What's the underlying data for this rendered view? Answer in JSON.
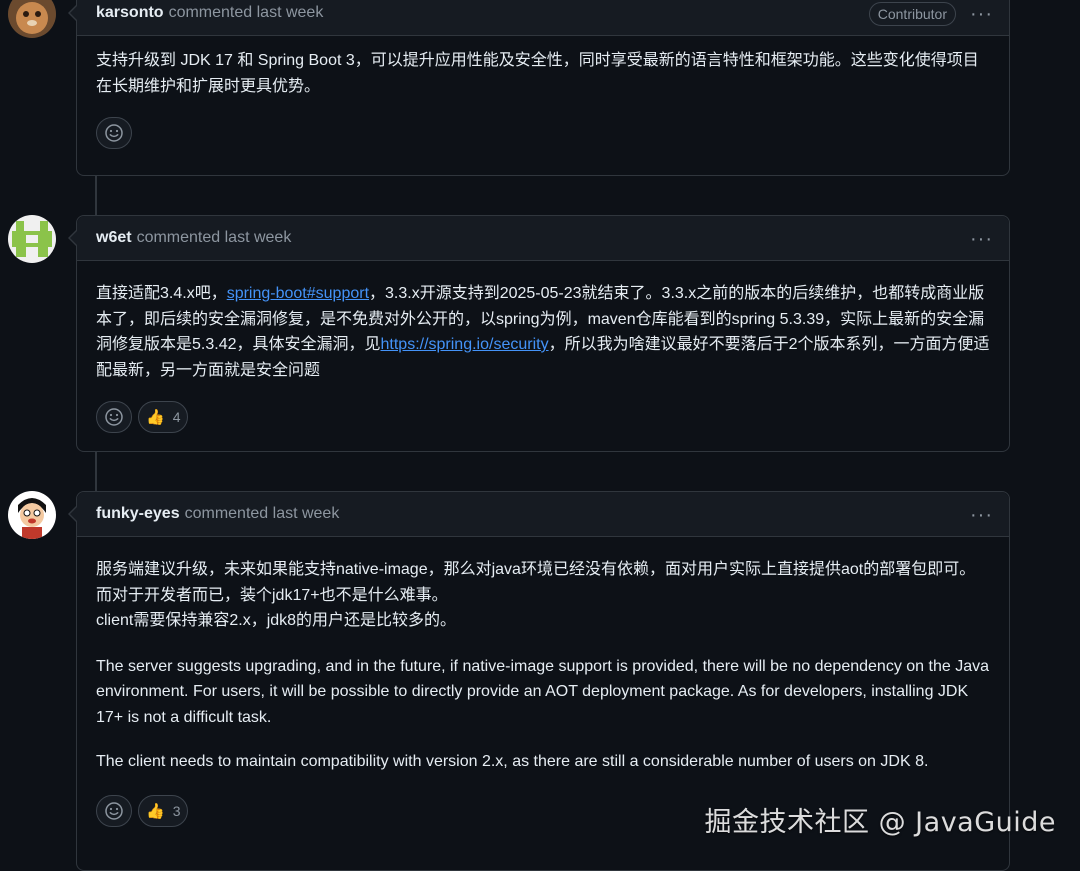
{
  "comments": [
    {
      "author": "karsonto",
      "meta": "commented last week",
      "badge": "Contributor",
      "kebab": "···",
      "body_p1": "支持升级到 JDK 17 和 Spring Boot 3，可以提升应用性能及安全性，同时享受最新的语言特性和框架功能。这些变化使得项目在长期维护和扩展时更具优势。"
    },
    {
      "author": "w6et",
      "meta": "commented last week",
      "kebab": "···",
      "body_a": "直接适配3.4.x吧，",
      "link1": "spring-boot#support",
      "body_b": "，3.3.x开源支持到2025-05-23就结束了。3.3.x之前的版本的后续维护，也都转成商业版本了，即后续的安全漏洞修复，是不免费对外公开的，以spring为例，maven仓库能看到的spring 5.3.39，实际上最新的安全漏洞修复版本是5.3.42，具体安全漏洞，见",
      "link2": "https://spring.io/security",
      "body_c": "，所以我为啥建议最好不要落后于2个版本系列，一方面方便适配最新，另一方面就是安全问题",
      "thumbs_count": "4"
    },
    {
      "author": "funky-eyes",
      "meta": "commented last week",
      "kebab": "···",
      "body_p1_line1": "服务端建议升级，未来如果能支持native-image，那么对java环境已经没有依赖，面对用户实际上直接提供aot的部署包即可。而对于开发者而已，装个jdk17+也不是什么难事。",
      "body_p1_line2": "client需要保持兼容2.x，jdk8的用户还是比较多的。",
      "body_p2": "The server suggests upgrading, and in the future, if native-image support is provided, there will be no dependency on the Java environment. For users, it will be possible to directly provide an AOT deployment package. As for developers, installing JDK 17+ is not a difficult task.",
      "body_p3": "The client needs to maintain compatibility with version 2.x, as there are still a considerable number of users on JDK 8.",
      "thumbs_count": "3"
    }
  ],
  "reaction_icons": {
    "add": "smiley-icon",
    "thumbs": "👍"
  },
  "watermark": "掘金技术社区 @ JavaGuide",
  "colors": {
    "background": "#0d1117",
    "border": "#30363d",
    "header": "#161b22",
    "link": "#4493f8",
    "muted": "#8d96a0"
  }
}
